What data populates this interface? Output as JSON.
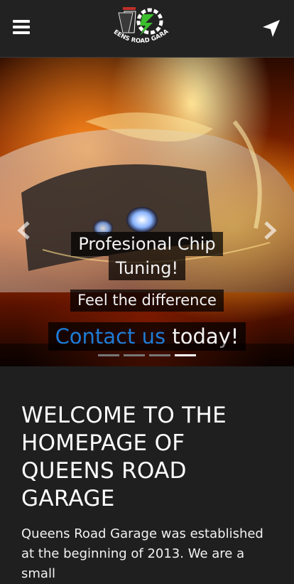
{
  "header": {
    "logo_text": "QUEENS ROAD GARAGE",
    "menu_icon": "hamburger-icon",
    "location_icon": "navigation-arrow-icon"
  },
  "hero": {
    "caption_line1": "Profesional Chip",
    "caption_line2": "Tuning!",
    "caption_sub": "Feel the difference",
    "cta_link": "Contact us",
    "cta_rest": " today!",
    "prev_icon": "chevron-left-icon",
    "next_icon": "chevron-right-icon",
    "slides_total": 4,
    "active_slide": 4
  },
  "main": {
    "heading": "WELCOME TO THE HOMEPAGE OF QUEENS ROAD GARAGE",
    "intro": "Queens Road Garage was established at the beginning of 2013. We are a small"
  },
  "colors": {
    "header_bg": "#222222",
    "body_bg": "#1f1f1f",
    "link": "#1e7cd6"
  }
}
